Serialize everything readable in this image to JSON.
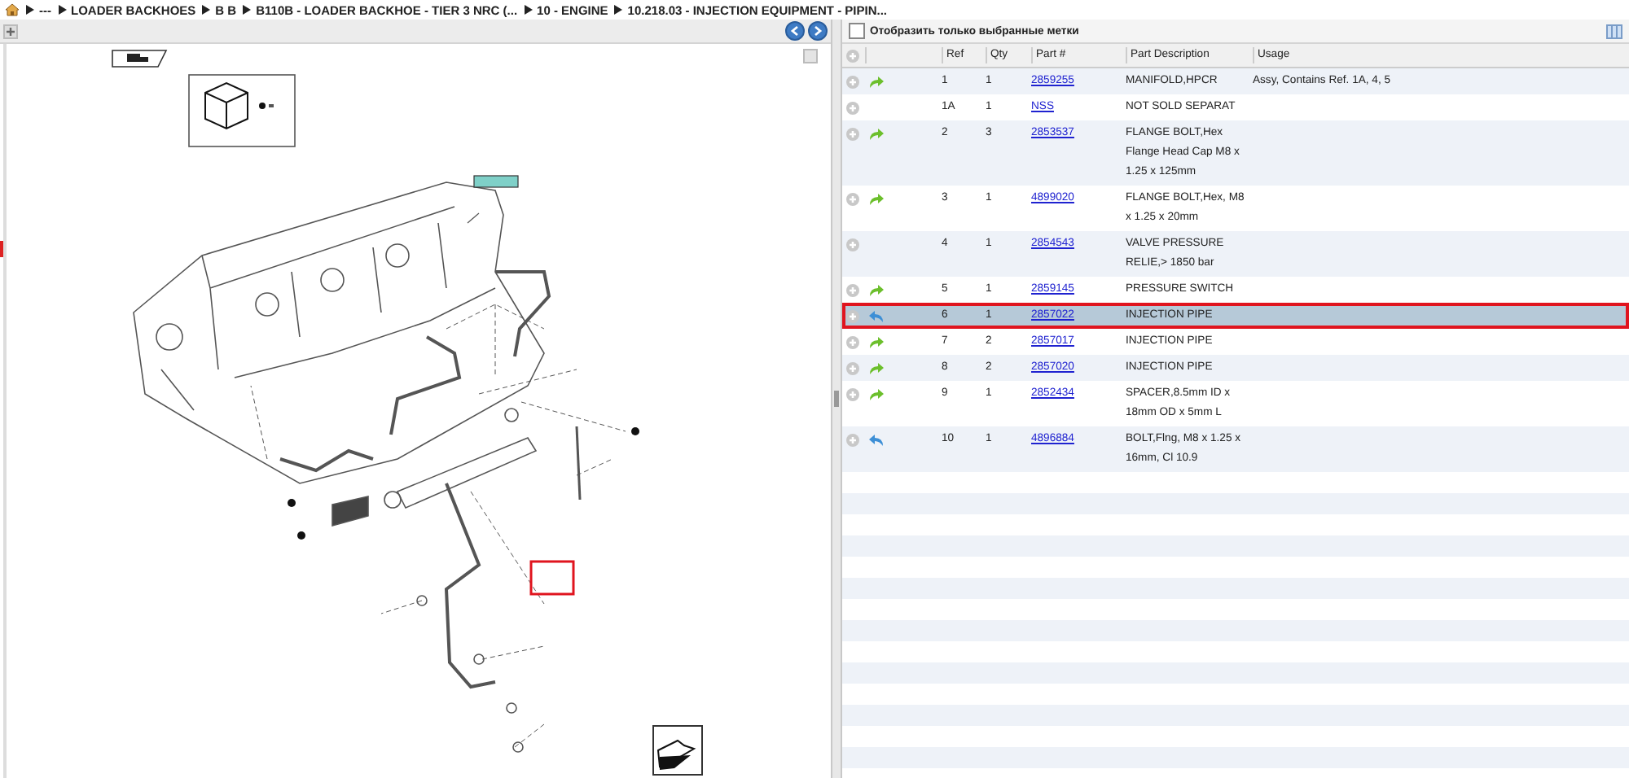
{
  "breadcrumb": [
    "---",
    "LOADER BACKHOES",
    "B B",
    "B110B - LOADER BACKHOE - TIER 3 NRC (...",
    "10 - ENGINE",
    "10.218.03 - INJECTION EQUIPMENT - PIPIN..."
  ],
  "filter": {
    "label": "Отобразить только выбранные метки",
    "checked": false
  },
  "table": {
    "columns": [
      "Ref",
      "Qty",
      "Part #",
      "Part Description",
      "Usage"
    ],
    "rows": [
      {
        "kind": "forward",
        "ref": "1",
        "qty": "1",
        "part": "2859255",
        "description": "MANIFOLD,HPCR",
        "usage": "Assy, Contains Ref. 1A, 4, 5",
        "selected": false
      },
      {
        "kind": "plain",
        "ref": "1A",
        "qty": "1",
        "part": "NSS",
        "description": "NOT SOLD SEPARAT",
        "selected": false
      },
      {
        "kind": "forward",
        "ref": "2",
        "qty": "3",
        "part": "2853537",
        "description": "FLANGE BOLT,Hex Flange Head Cap M8 x 1.25 x 125mm",
        "selected": false
      },
      {
        "kind": "forward",
        "ref": "3",
        "qty": "1",
        "part": "4899020",
        "description": "FLANGE BOLT,Hex, M8 x 1.25 x 20mm",
        "selected": false
      },
      {
        "kind": "plain",
        "ref": "4",
        "qty": "1",
        "part": "2854543",
        "description": "VALVE PRESSURE RELIE,> 1850 bar",
        "selected": false
      },
      {
        "kind": "forward",
        "ref": "5",
        "qty": "1",
        "part": "2859145",
        "description": "PRESSURE SWITCH",
        "selected": false
      },
      {
        "kind": "back",
        "ref": "6",
        "qty": "1",
        "part": "2857022",
        "description": "INJECTION PIPE",
        "selected": true
      },
      {
        "kind": "forward",
        "ref": "7",
        "qty": "2",
        "part": "2857017",
        "description": "INJECTION PIPE",
        "selected": false
      },
      {
        "kind": "forward",
        "ref": "8",
        "qty": "2",
        "part": "2857020",
        "description": "INJECTION PIPE",
        "selected": false
      },
      {
        "kind": "forward",
        "ref": "9",
        "qty": "1",
        "part": "2852434",
        "description": "SPACER,8.5mm ID x 18mm OD x 5mm L",
        "selected": false
      },
      {
        "kind": "back",
        "ref": "10",
        "qty": "1",
        "part": "4896884",
        "description": "BOLT,Flng, M8 x 1.25 x 16mm, Cl 10.9",
        "selected": false
      }
    ]
  }
}
